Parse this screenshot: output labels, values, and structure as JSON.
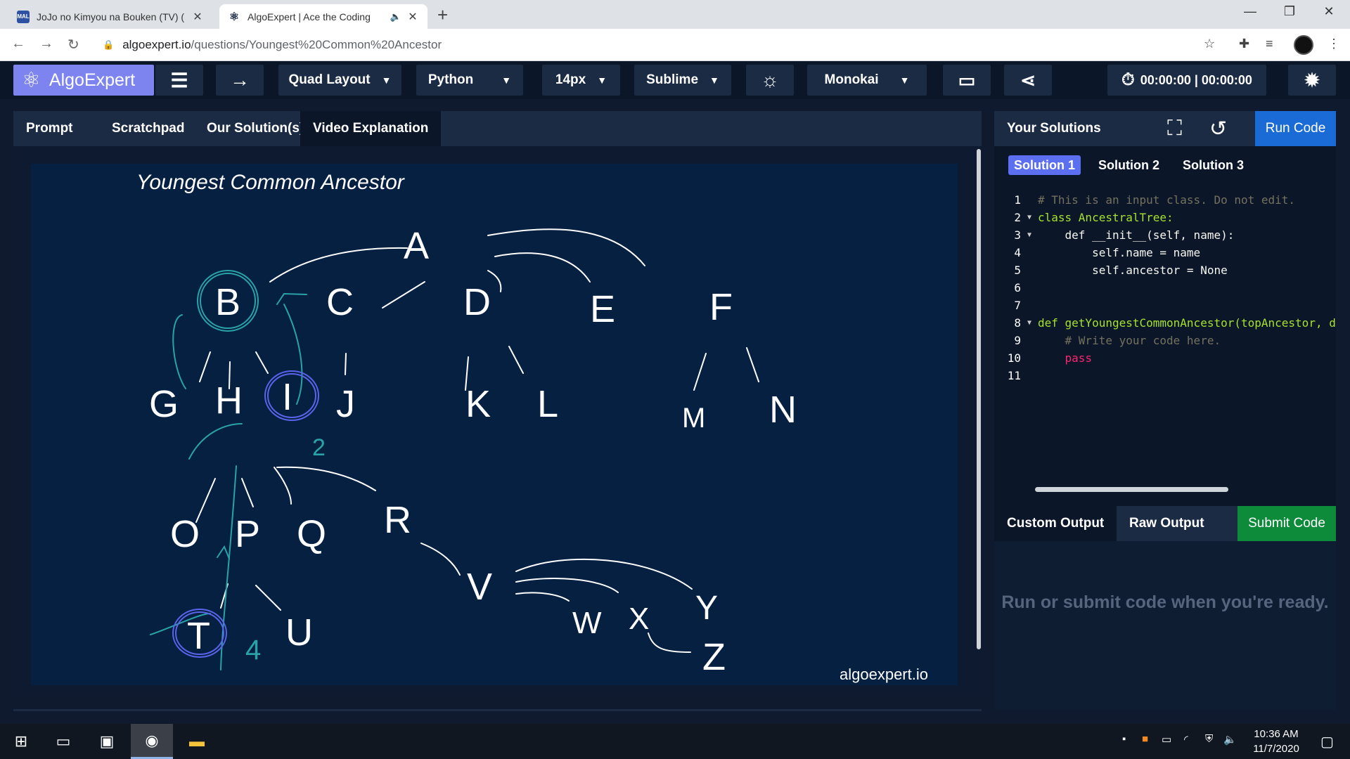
{
  "browser": {
    "tabs": [
      {
        "title": "JoJo no Kimyou na Bouken (TV) (",
        "favicon_text": "MAL",
        "active": false
      },
      {
        "title": "AlgoExpert | Ace the Coding",
        "active": true
      }
    ],
    "url_host": "algoexpert.io",
    "url_path": "/questions/Youngest%20Common%20Ancestor"
  },
  "toolbar": {
    "logo_label": "AlgoExpert",
    "layout_label": "Quad Layout",
    "language_label": "Python",
    "fontsize_label": "14px",
    "keymap_label": "Sublime",
    "theme_label": "Monokai",
    "timer_label": "00:00:00 | 00:00:00"
  },
  "left_tabs": [
    "Prompt",
    "Scratchpad",
    "Our Solution(s)",
    "Video Explanation"
  ],
  "video": {
    "title": "Youngest Common Ancestor",
    "watermark": "algoexpert.io",
    "tree_labels": [
      "A",
      "B",
      "C",
      "D",
      "E",
      "F",
      "G",
      "H",
      "I",
      "J",
      "K",
      "L",
      "M",
      "N",
      "O",
      "P",
      "Q",
      "R",
      "T",
      "U",
      "V",
      "W",
      "X",
      "Y",
      "Z"
    ],
    "annotations": [
      "2",
      "4"
    ]
  },
  "right": {
    "title": "Your Solutions",
    "run_label": "Run Code",
    "solution_tabs": [
      "Solution 1",
      "Solution 2",
      "Solution 3"
    ],
    "code_lines": [
      {
        "n": "1",
        "text": "# This is an input class. Do not edit."
      },
      {
        "n": "2",
        "text": "class AncestralTree:"
      },
      {
        "n": "3",
        "text": "    def __init__(self, name):"
      },
      {
        "n": "4",
        "text": "        self.name = name"
      },
      {
        "n": "5",
        "text": "        self.ancestor = None"
      },
      {
        "n": "6",
        "text": ""
      },
      {
        "n": "7",
        "text": ""
      },
      {
        "n": "8",
        "text": "def getYoungestCommonAncestor(topAncestor, d"
      },
      {
        "n": "9",
        "text": "    # Write your code here."
      },
      {
        "n": "10",
        "text": "    pass"
      },
      {
        "n": "11",
        "text": ""
      }
    ],
    "output_tabs": [
      "Custom Output",
      "Raw Output"
    ],
    "submit_label": "Submit Code",
    "output_message": "Run or submit code when you're ready."
  },
  "taskbar": {
    "time": "10:36 AM",
    "date": "11/7/2020"
  }
}
